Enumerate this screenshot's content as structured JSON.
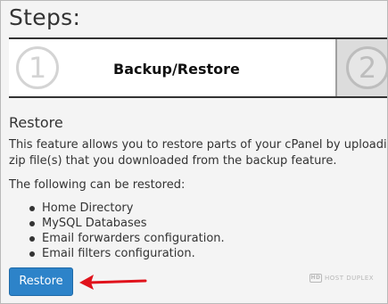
{
  "page": {
    "title": "Steps:"
  },
  "steps": [
    {
      "number": "1",
      "label": "Backup/Restore"
    },
    {
      "number": "2",
      "label": ""
    }
  ],
  "restore": {
    "heading": "Restore",
    "description_line1": "This feature allows you to restore parts of your cPanel by uploading yo",
    "description_line2": "zip file(s) that you downloaded from the backup feature.",
    "list_intro": "The following can be restored:",
    "items": [
      "Home Directory",
      "MySQL Databases",
      "Email forwarders configuration.",
      "Email filters configuration."
    ],
    "button_label": "Restore"
  },
  "watermark": {
    "logo": "HD",
    "text": "HOST DUPLEX"
  },
  "colors": {
    "button": "#2d83c9",
    "arrow": "#e0121b",
    "background": "#f4f4f4"
  },
  "icons": {
    "arrow": "arrow-left-icon"
  }
}
